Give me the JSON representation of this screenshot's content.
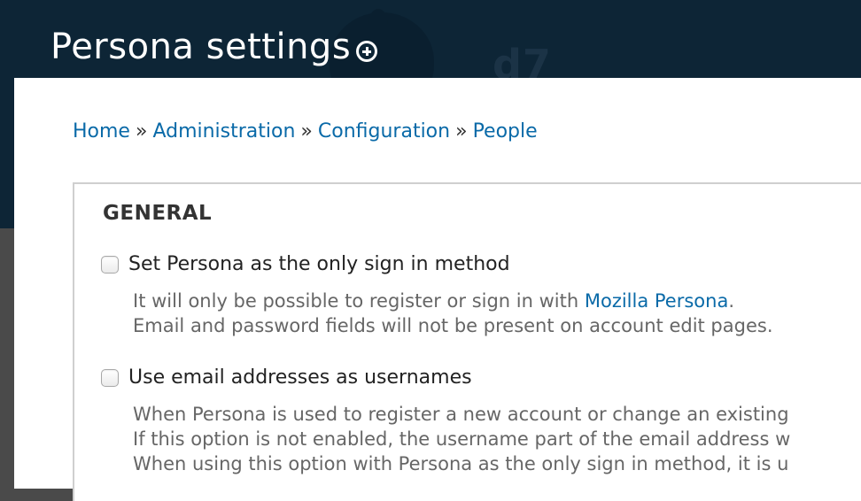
{
  "header": {
    "title": "Persona settings",
    "shortcut_icon": "add-shortcut-icon",
    "watermark": "d7"
  },
  "breadcrumb": [
    {
      "label": "Home"
    },
    {
      "label": "Administration"
    },
    {
      "label": "Configuration"
    },
    {
      "label": "People"
    }
  ],
  "breadcrumb_separator": "»",
  "fieldset": {
    "legend": "GENERAL",
    "options": [
      {
        "label": "Set Persona as the only sign in method",
        "checked": false,
        "desc_line1_pre": "It will only be possible to register or sign in with ",
        "desc_line1_link": "Mozilla Persona",
        "desc_line1_post": ".",
        "desc_line2": "Email and password fields will not be present on account edit pages."
      },
      {
        "label": "Use email addresses as usernames",
        "checked": false,
        "desc_line1": "When Persona is used to register a new account or change an existing",
        "desc_line2": "If this option is not enabled, the username part of the email address w",
        "desc_line3": "When using this option with Persona as the only sign in method, it is u"
      }
    ]
  },
  "colors": {
    "header_bg": "#0d2536",
    "link": "#0a6aa8",
    "text": "#222222",
    "description": "#666666"
  }
}
